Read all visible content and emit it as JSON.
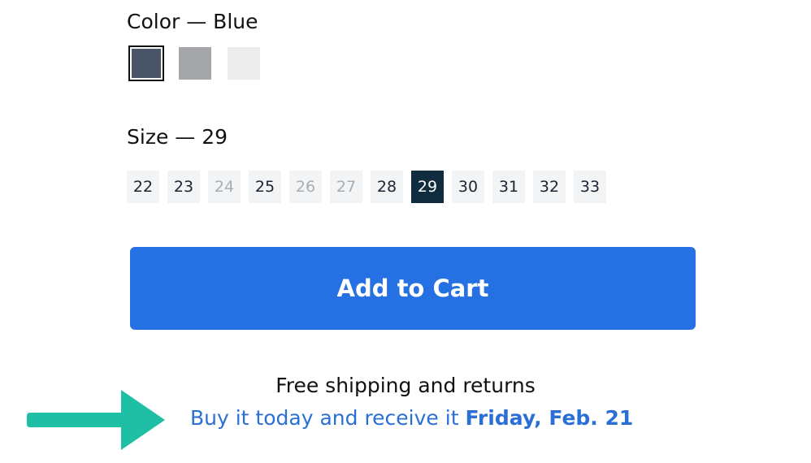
{
  "color": {
    "label": "Color — Blue",
    "swatches": [
      {
        "name": "Blue",
        "hex": "#4a5468",
        "selected": true
      },
      {
        "name": "Grey",
        "hex": "#a4a5a9",
        "selected": false
      },
      {
        "name": "White",
        "hex": "#ececec",
        "selected": false
      }
    ]
  },
  "size": {
    "label": "Size — 29",
    "options": [
      {
        "value": "22",
        "state": "available"
      },
      {
        "value": "23",
        "state": "available"
      },
      {
        "value": "24",
        "state": "unavailable"
      },
      {
        "value": "25",
        "state": "available"
      },
      {
        "value": "26",
        "state": "unavailable"
      },
      {
        "value": "27",
        "state": "unavailable"
      },
      {
        "value": "28",
        "state": "available"
      },
      {
        "value": "29",
        "state": "selected"
      },
      {
        "value": "30",
        "state": "available"
      },
      {
        "value": "31",
        "state": "available"
      },
      {
        "value": "32",
        "state": "available"
      },
      {
        "value": "33",
        "state": "available"
      }
    ]
  },
  "cart": {
    "button_label": "Add to Cart",
    "color": "#2570e2"
  },
  "shipping": {
    "text": "Free shipping and returns"
  },
  "delivery": {
    "prefix": "Buy it today and receive it",
    "date": "Friday, Feb. 21",
    "color": "#2a6fd6"
  },
  "arrow": {
    "icon": "arrow-right-icon",
    "color": "#1fbfa6"
  }
}
